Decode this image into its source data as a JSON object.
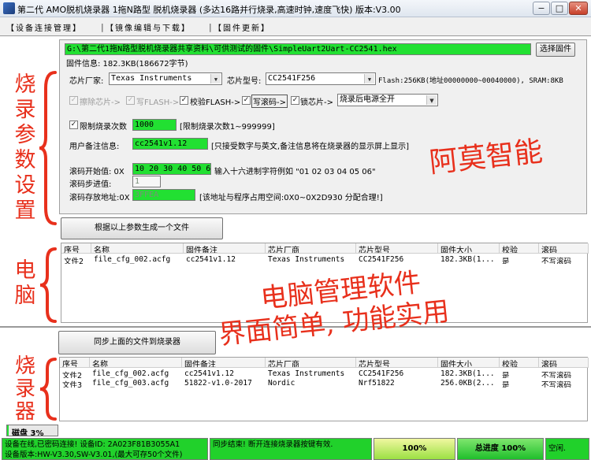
{
  "window": {
    "title": "第二代 AMO脱机烧录器 1拖N路型 脱机烧录器 (多达16路并行烧录,高速时钟,速度飞快) 版本:V3.00",
    "min_label": "−",
    "max_label": "□",
    "close_label": "✕"
  },
  "tabs": [
    {
      "label": "【设备连接管理】"
    },
    {
      "label": "【镜像编辑与下载】"
    },
    {
      "label": "【固件更新】"
    }
  ],
  "tab_separators": [
    "|",
    "|"
  ],
  "firmware": {
    "path": "G:\\第二代1拖N路型脱机烧录器共享资料\\可供测试的固件\\SimpleUart2Uart-CC2541.hex",
    "select_button": "选择固件",
    "info": "固件信息: 182.3KB(186672字节)"
  },
  "chip": {
    "vendor_label": "芯片厂家:",
    "vendor_value": "Texas Instruments",
    "model_label": "芯片型号:",
    "model_value": "CC2541F256",
    "flash_info": "Flash:256KB(地址00000000~00040000), SRAM:8KB"
  },
  "ops": [
    {
      "label": "擦除芯片->",
      "checked": true,
      "enabled": false
    },
    {
      "label": "写FLASH->",
      "checked": true,
      "enabled": false
    },
    {
      "label": "校验FLASH->",
      "checked": true,
      "enabled": true
    },
    {
      "label": "写滚码->",
      "checked": true,
      "enabled": true
    },
    {
      "label": "锁芯片->",
      "checked": true,
      "enabled": true
    }
  ],
  "after_burn": {
    "value": "烧录后电源全开"
  },
  "limit": {
    "checkbox_label": "限制烧录次数",
    "checked": true,
    "value": "1000",
    "hint": "[限制烧录次数1~999999]"
  },
  "remark": {
    "label": "用户备注信息:",
    "value": "cc2541v1.12",
    "hint": "[只接受数字与英文,备注信息将在烧录器的显示屏上显示]"
  },
  "rolling": {
    "start_label": "滚码开始值: 0X",
    "start_value": "10 20 30 40 50 60",
    "start_hint": "输入十六进制字符例如 \"01 02 03 04 05 06\"",
    "step_label": "滚码步进值:",
    "step_value": "1",
    "addr_label": "滚码存放地址:0X",
    "addr_value": "3FFEA",
    "addr_hint": "[该地址与程序占用空间:0X0~0X2D930 分配合理!]"
  },
  "overlay": {
    "brand": "阿莫智能",
    "pc_side": "电\n脑",
    "params_side": "烧\n录\n参\n数\n设\n置",
    "burner_side": "烧\n录\n器",
    "slogan_line1": "电脑管理软件",
    "slogan_line2": "界面简单, 功能实用"
  },
  "gen_button": "根据以上参数生成一个文件",
  "sync_button": "同步上面的文件到烧录器",
  "columns": [
    "序号",
    "名称",
    "固件备注",
    "芯片厂商",
    "芯片型号",
    "固件大小",
    "校验",
    "滚码"
  ],
  "pc_table": [
    {
      "no": "文件2",
      "name": "file_cfg_002.acfg",
      "remark": "cc2541v1.12",
      "vendor": "Texas Instruments",
      "model": "CC2541F256",
      "size": "182.3KB(1...",
      "verify": "是",
      "rolling": "不写滚码"
    }
  ],
  "burner_table": [
    {
      "no": "文件2",
      "name": "file_cfg_002.acfg",
      "remark": "cc2541v1.12",
      "vendor": "Texas Instruments",
      "model": "CC2541F256",
      "size": "182.3KB(1...",
      "verify": "是",
      "rolling": "不写滚码"
    },
    {
      "no": "文件3",
      "name": "file_cfg_003.acfg",
      "remark": "51822-v1.0-2017",
      "vendor": "Nordic",
      "model": "Nrf51822",
      "size": "256.0KB(2...",
      "verify": "是",
      "rolling": "不写滚码"
    }
  ],
  "disk": {
    "label": "磁盘 3%",
    "percent": 3
  },
  "status": {
    "device_line1": "设备在线,已密码连接! 设备ID: 2A023F81B3055A1",
    "device_line2": "设备版本:HW-V3.30,SW-V3.01,(最大可存50个文件)",
    "sync": "同步结束! 断开连接烧录器按键有效.",
    "progress1": "100%",
    "progress_total": "总进度 100%",
    "idle": "空闲.",
    "progress1_fraction": 1.0,
    "progress_total_fraction": 1.0
  },
  "colors": {
    "green_field": "#22e032",
    "status_green": "#21d12b",
    "overlay_red": "#e8301c"
  }
}
